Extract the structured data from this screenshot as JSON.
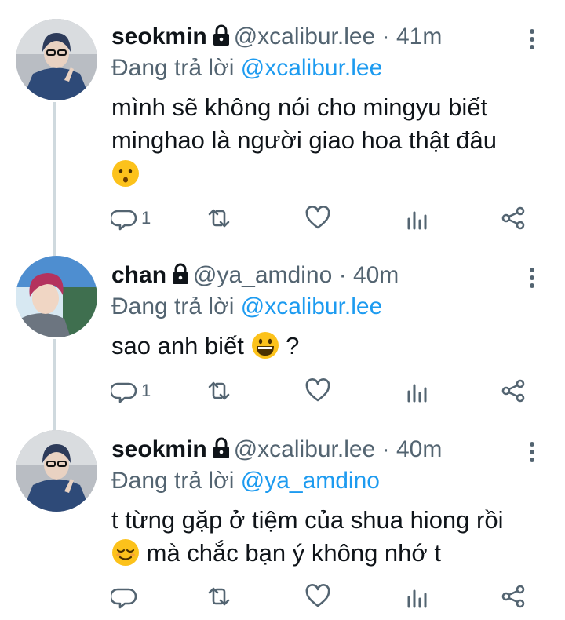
{
  "replying_prefix": "Đang trả lời",
  "colors": {
    "link": "#1d9bf0",
    "muted": "#536471",
    "text": "#0f1419",
    "thread_line": "#cfd9de"
  },
  "tweets": [
    {
      "name": "seokmin",
      "protected": true,
      "handle": "@xcalibur.lee",
      "separator": "·",
      "time": "41m",
      "replying_to": "@xcalibur.lee",
      "lines": [
        "mình sẽ không nói cho mingyu biết",
        "minghao là người giao hoa thật đâu"
      ],
      "trailing_emoji": "kissing-face",
      "reply_count": "1"
    },
    {
      "name": "chan",
      "protected": true,
      "handle": "@ya_amdino",
      "separator": "·",
      "time": "40m",
      "replying_to": "@xcalibur.lee",
      "text_before": "sao anh biết",
      "inline_emoji": "grinning-face",
      "text_after": "?",
      "reply_count": "1"
    },
    {
      "name": "seokmin",
      "protected": true,
      "handle": "@xcalibur.lee",
      "separator": "·",
      "time": "40m",
      "replying_to": "@ya_amdino",
      "line1": "t từng gặp ở tiệm của shua hiong rồi",
      "leading_emoji": "relieved-face",
      "line2": "mà chắc bạn ý không nhớ t",
      "reply_count": ""
    }
  ],
  "icons": [
    "reply-icon",
    "retweet-icon",
    "like-icon",
    "analytics-icon",
    "share-icon",
    "more-options-icon",
    "lock-icon"
  ]
}
